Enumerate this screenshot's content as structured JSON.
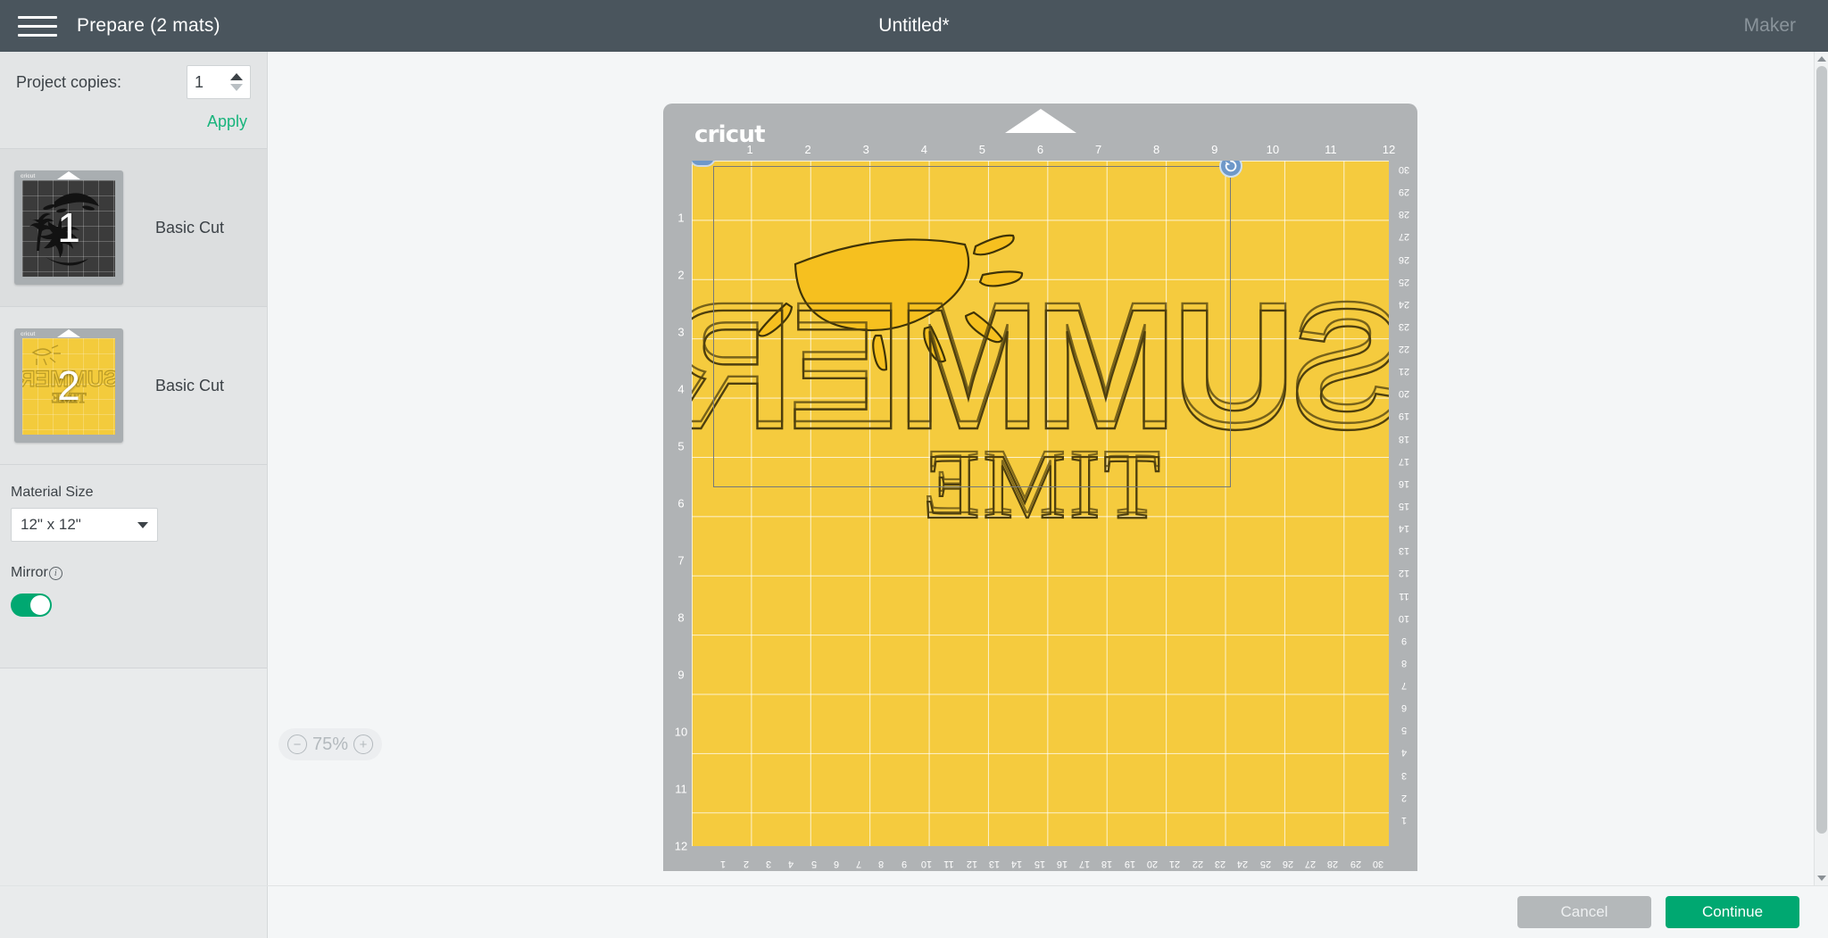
{
  "header": {
    "menu_icon": "hamburger-menu-icon",
    "title": "Prepare (2 mats)",
    "document_title": "Untitled*",
    "machine": "Maker"
  },
  "sidebar": {
    "project_copies_label": "Project copies:",
    "project_copies_value": "1",
    "apply_label": "Apply",
    "mats": [
      {
        "number": "1",
        "label": "Basic Cut",
        "surface": "dark",
        "selected": true
      },
      {
        "number": "2",
        "label": "Basic Cut",
        "surface": "yellow",
        "selected": false
      }
    ],
    "material_size_label": "Material Size",
    "material_size_value": "12\" x 12\"",
    "mirror_label": "Mirror",
    "mirror_on": true
  },
  "canvas": {
    "brand": "cricut",
    "ruler_top": [
      "1",
      "2",
      "3",
      "4",
      "5",
      "6",
      "7",
      "8",
      "9",
      "10",
      "11",
      "12"
    ],
    "ruler_left": [
      "1",
      "2",
      "3",
      "4",
      "5",
      "6",
      "7",
      "8",
      "9",
      "10",
      "11",
      "12"
    ],
    "ruler_right": [
      "30",
      "29",
      "28",
      "27",
      "26",
      "25",
      "24",
      "23",
      "22",
      "21",
      "20",
      "19",
      "18",
      "17",
      "16",
      "15",
      "14",
      "13",
      "12",
      "11",
      "10",
      "9",
      "8",
      "7",
      "6",
      "5",
      "4",
      "3",
      "2",
      "1"
    ],
    "ruler_bottom": [
      "30",
      "29",
      "28",
      "27",
      "26",
      "25",
      "24",
      "23",
      "22",
      "21",
      "20",
      "19",
      "18",
      "17",
      "16",
      "15",
      "14",
      "13",
      "12",
      "11",
      "10",
      "9",
      "8",
      "7",
      "6",
      "5",
      "4",
      "3",
      "2",
      "1"
    ],
    "mat_color": "#f5cb3e",
    "design_text_line1": "SUMMER",
    "design_text_line2": "TIME",
    "design_mirrored": true,
    "selection_handles": {
      "options": "ellipsis-handle",
      "rotate": "rotate-handle"
    }
  },
  "zoom": {
    "minus_label": "−",
    "value": "75%",
    "plus_label": "+"
  },
  "footer": {
    "cancel_label": "Cancel",
    "continue_label": "Continue"
  },
  "colors": {
    "header_bg": "#4a555d",
    "accent_green": "#00a871",
    "mat_yellow": "#f5cb3e",
    "design_stroke": "#5a4a14"
  }
}
